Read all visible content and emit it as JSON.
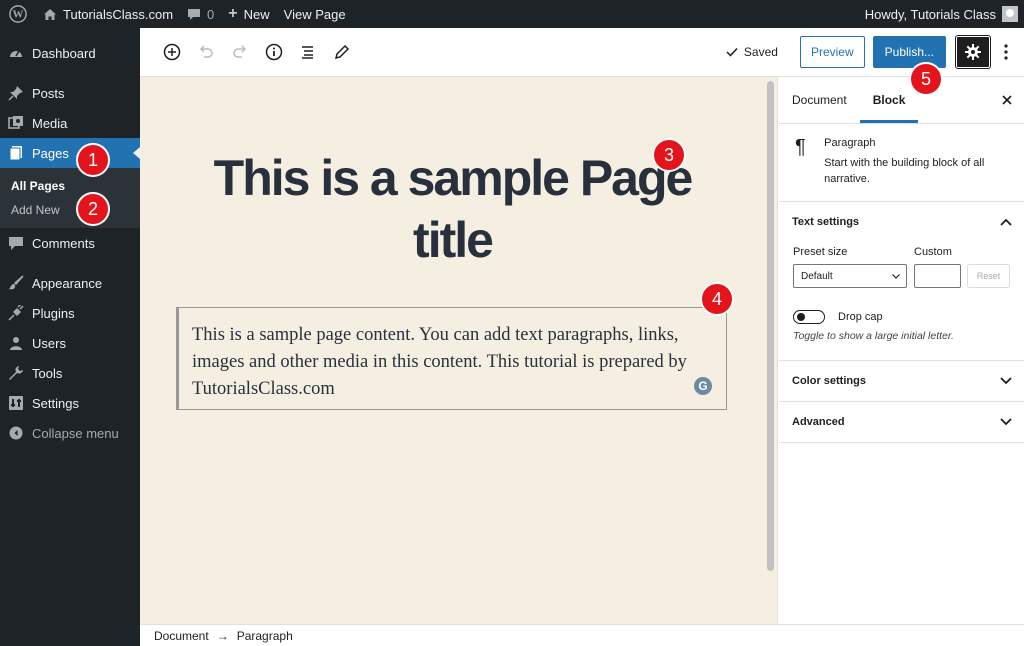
{
  "admin_bar": {
    "site_name": "TutorialsClass.com",
    "comments_count": "0",
    "new_label": "New",
    "view_page_label": "View Page",
    "greeting": "Howdy, Tutorials Class"
  },
  "sidebar": {
    "items": [
      {
        "label": "Dashboard",
        "icon": "dashboard-icon"
      },
      {
        "label": "Posts",
        "icon": "pin-icon"
      },
      {
        "label": "Media",
        "icon": "media-icon"
      },
      {
        "label": "Pages",
        "icon": "pages-icon"
      },
      {
        "label": "Comments",
        "icon": "comments-icon"
      },
      {
        "label": "Appearance",
        "icon": "brush-icon"
      },
      {
        "label": "Plugins",
        "icon": "plug-icon"
      },
      {
        "label": "Users",
        "icon": "users-icon"
      },
      {
        "label": "Tools",
        "icon": "wrench-icon"
      },
      {
        "label": "Settings",
        "icon": "settings-icon"
      }
    ],
    "submenu": [
      {
        "label": "All Pages"
      },
      {
        "label": "Add New"
      }
    ],
    "collapse_label": "Collapse menu"
  },
  "toolbar": {
    "saved_label": "Saved",
    "preview_label": "Preview",
    "publish_label": "Publish..."
  },
  "editor": {
    "title": "This is a sample Page title",
    "paragraph": "This is a sample page content. You can add text paragraphs, links, images and other media in this content. This tutorial is prepared by TutorialsClass.com"
  },
  "breadcrumb": {
    "root": "Document",
    "separator": "→",
    "current": "Paragraph"
  },
  "panel": {
    "tabs": [
      "Document",
      "Block"
    ],
    "active_tab": "Block",
    "block_name": "Paragraph",
    "block_description": "Start with the building block of all narrative.",
    "text_settings": {
      "title": "Text settings",
      "preset_label": "Preset size",
      "custom_label": "Custom",
      "preset_value": "Default",
      "reset_label": "Reset",
      "drop_cap_label": "Drop cap",
      "drop_cap_help": "Toggle to show a large initial letter."
    },
    "color_settings_label": "Color settings",
    "advanced_label": "Advanced"
  },
  "markers": [
    "1",
    "2",
    "3",
    "4",
    "5"
  ],
  "colors": {
    "admin_dark": "#1d2327",
    "accent_blue": "#2271b1",
    "canvas_bg": "#f4efe1",
    "marker_red": "#e3141c"
  }
}
